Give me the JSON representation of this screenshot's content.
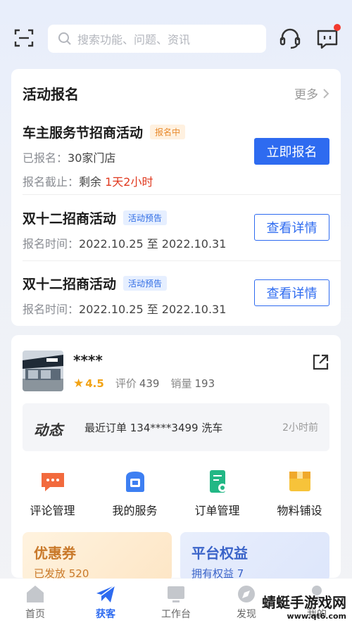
{
  "search": {
    "placeholder": "搜索功能、问题、资讯"
  },
  "activity": {
    "title": "活动报名",
    "more": "更多",
    "items": [
      {
        "name": "车主服务节招商活动",
        "tag": "报名中",
        "line1_label": "已报名：",
        "line1_value": "30家门店",
        "line2_label": "报名截止：",
        "line2_prefix": "剩余",
        "line2_value": "1天2小时",
        "button": "立即报名"
      },
      {
        "name": "双十二招商活动",
        "tag": "活动预告",
        "line1_label": "报名时间：",
        "line1_value": "2022.10.25 至 2022.10.31",
        "button": "查看详情"
      },
      {
        "name": "双十二招商活动",
        "tag": "活动预告",
        "line1_label": "报名时间：",
        "line1_value": "2022.10.25 至 2022.10.31",
        "button": "查看详情"
      }
    ]
  },
  "store": {
    "name": "****",
    "rating": "4.5",
    "review_label": "评价",
    "review_count": "439",
    "sales_label": "销量",
    "sales_count": "193",
    "feed_logo": "动态",
    "feed_text": "最近订单 134****3499 洗车",
    "feed_time": "2小时前"
  },
  "shortcuts": [
    {
      "label": "评论管理",
      "icon": "comment-icon",
      "color": "#f26a3d"
    },
    {
      "label": "我的服务",
      "icon": "service-icon",
      "color": "#3d7ff2"
    },
    {
      "label": "订单管理",
      "icon": "order-icon",
      "color": "#22b785"
    },
    {
      "label": "物料铺设",
      "icon": "material-icon",
      "color": "#f7c33a"
    }
  ],
  "promos": [
    {
      "title": "优惠券",
      "sub": "已发放 520"
    },
    {
      "title": "平台权益",
      "sub": "拥有权益 7"
    }
  ],
  "tabs": [
    {
      "label": "首页"
    },
    {
      "label": "获客"
    },
    {
      "label": "工作台"
    },
    {
      "label": "发现"
    },
    {
      "label": "我的"
    }
  ],
  "watermark": {
    "line1": "蜻蜓手游戏网",
    "line2": "www.qt6.com"
  },
  "colors": {
    "accent": "#2e6bf0",
    "urgent": "#e0391f",
    "star": "#f2a315"
  }
}
